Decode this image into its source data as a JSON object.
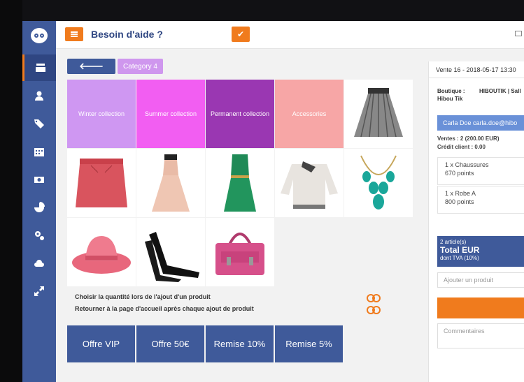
{
  "topbar": {
    "help_title": "Besoin d'aide ?"
  },
  "breadcrumb": {
    "back_icon": "arrow-left-icon",
    "category": "Category 4"
  },
  "categories": [
    {
      "label": "Winter collection",
      "color": "#cf97f2"
    },
    {
      "label": "Summer collection",
      "color": "#f25ef2"
    },
    {
      "label": "Permanent collection",
      "color": "#9a37b2"
    },
    {
      "label": "Accessories",
      "color": "#f7a6a6"
    }
  ],
  "options": [
    {
      "label": "Choisir la quantité lors de l'ajout d'un produit"
    },
    {
      "label": "Retourner à la page d'accueil après chaque ajout de produit"
    }
  ],
  "offers": [
    {
      "label": "Offre VIP"
    },
    {
      "label": "Offre 50€"
    },
    {
      "label": "Remise 10%"
    },
    {
      "label": "Remise 5%"
    }
  ],
  "panel": {
    "sale_header": "Vente 16 - 2018-05-17 13:30",
    "shop_label": "Boutique :",
    "shop_value": "HIBOUTIK | Sall",
    "shop_value2": "Hibou Tik",
    "client": "Carla Doe carla.doe@hibo",
    "ventes": "Ventes : 2 (200.00 EUR)",
    "credit": "Crédit client : 0.00",
    "items": [
      {
        "name": "1 x Chaussures",
        "points": "670 points"
      },
      {
        "name": "1 x Robe A",
        "points": "800 points"
      }
    ],
    "articles": "2 article(s)",
    "total": "Total EUR",
    "tva": "dont TVA (10%)",
    "add_placeholder": "Ajouter un produit",
    "comments_placeholder": "Commentaires"
  },
  "colors": {
    "sidebar": "#3f5a9a",
    "accent": "#f07b1d",
    "client_bar": "#6a91d8"
  },
  "sidebar_icons": [
    "owl-logo-icon",
    "register-icon",
    "user-icon",
    "tags-icon",
    "calendar-icon",
    "cash-icon",
    "pie-chart-icon",
    "settings-icon",
    "cloud-icon",
    "expand-icon"
  ]
}
